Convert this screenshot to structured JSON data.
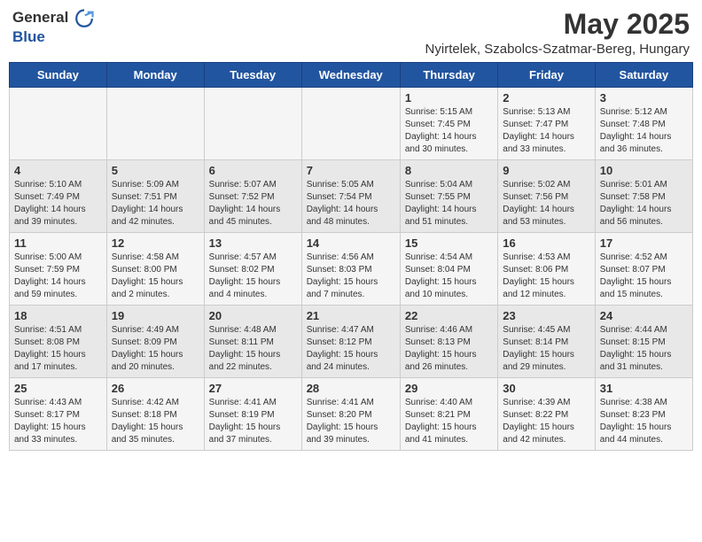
{
  "header": {
    "logo_general": "General",
    "logo_blue": "Blue",
    "month": "May 2025",
    "location": "Nyirtelek, Szabolcs-Szatmar-Bereg, Hungary"
  },
  "days_of_week": [
    "Sunday",
    "Monday",
    "Tuesday",
    "Wednesday",
    "Thursday",
    "Friday",
    "Saturday"
  ],
  "weeks": [
    [
      {
        "day": "",
        "info": ""
      },
      {
        "day": "",
        "info": ""
      },
      {
        "day": "",
        "info": ""
      },
      {
        "day": "",
        "info": ""
      },
      {
        "day": "1",
        "info": "Sunrise: 5:15 AM\nSunset: 7:45 PM\nDaylight: 14 hours\nand 30 minutes."
      },
      {
        "day": "2",
        "info": "Sunrise: 5:13 AM\nSunset: 7:47 PM\nDaylight: 14 hours\nand 33 minutes."
      },
      {
        "day": "3",
        "info": "Sunrise: 5:12 AM\nSunset: 7:48 PM\nDaylight: 14 hours\nand 36 minutes."
      }
    ],
    [
      {
        "day": "4",
        "info": "Sunrise: 5:10 AM\nSunset: 7:49 PM\nDaylight: 14 hours\nand 39 minutes."
      },
      {
        "day": "5",
        "info": "Sunrise: 5:09 AM\nSunset: 7:51 PM\nDaylight: 14 hours\nand 42 minutes."
      },
      {
        "day": "6",
        "info": "Sunrise: 5:07 AM\nSunset: 7:52 PM\nDaylight: 14 hours\nand 45 minutes."
      },
      {
        "day": "7",
        "info": "Sunrise: 5:05 AM\nSunset: 7:54 PM\nDaylight: 14 hours\nand 48 minutes."
      },
      {
        "day": "8",
        "info": "Sunrise: 5:04 AM\nSunset: 7:55 PM\nDaylight: 14 hours\nand 51 minutes."
      },
      {
        "day": "9",
        "info": "Sunrise: 5:02 AM\nSunset: 7:56 PM\nDaylight: 14 hours\nand 53 minutes."
      },
      {
        "day": "10",
        "info": "Sunrise: 5:01 AM\nSunset: 7:58 PM\nDaylight: 14 hours\nand 56 minutes."
      }
    ],
    [
      {
        "day": "11",
        "info": "Sunrise: 5:00 AM\nSunset: 7:59 PM\nDaylight: 14 hours\nand 59 minutes."
      },
      {
        "day": "12",
        "info": "Sunrise: 4:58 AM\nSunset: 8:00 PM\nDaylight: 15 hours\nand 2 minutes."
      },
      {
        "day": "13",
        "info": "Sunrise: 4:57 AM\nSunset: 8:02 PM\nDaylight: 15 hours\nand 4 minutes."
      },
      {
        "day": "14",
        "info": "Sunrise: 4:56 AM\nSunset: 8:03 PM\nDaylight: 15 hours\nand 7 minutes."
      },
      {
        "day": "15",
        "info": "Sunrise: 4:54 AM\nSunset: 8:04 PM\nDaylight: 15 hours\nand 10 minutes."
      },
      {
        "day": "16",
        "info": "Sunrise: 4:53 AM\nSunset: 8:06 PM\nDaylight: 15 hours\nand 12 minutes."
      },
      {
        "day": "17",
        "info": "Sunrise: 4:52 AM\nSunset: 8:07 PM\nDaylight: 15 hours\nand 15 minutes."
      }
    ],
    [
      {
        "day": "18",
        "info": "Sunrise: 4:51 AM\nSunset: 8:08 PM\nDaylight: 15 hours\nand 17 minutes."
      },
      {
        "day": "19",
        "info": "Sunrise: 4:49 AM\nSunset: 8:09 PM\nDaylight: 15 hours\nand 20 minutes."
      },
      {
        "day": "20",
        "info": "Sunrise: 4:48 AM\nSunset: 8:11 PM\nDaylight: 15 hours\nand 22 minutes."
      },
      {
        "day": "21",
        "info": "Sunrise: 4:47 AM\nSunset: 8:12 PM\nDaylight: 15 hours\nand 24 minutes."
      },
      {
        "day": "22",
        "info": "Sunrise: 4:46 AM\nSunset: 8:13 PM\nDaylight: 15 hours\nand 26 minutes."
      },
      {
        "day": "23",
        "info": "Sunrise: 4:45 AM\nSunset: 8:14 PM\nDaylight: 15 hours\nand 29 minutes."
      },
      {
        "day": "24",
        "info": "Sunrise: 4:44 AM\nSunset: 8:15 PM\nDaylight: 15 hours\nand 31 minutes."
      }
    ],
    [
      {
        "day": "25",
        "info": "Sunrise: 4:43 AM\nSunset: 8:17 PM\nDaylight: 15 hours\nand 33 minutes."
      },
      {
        "day": "26",
        "info": "Sunrise: 4:42 AM\nSunset: 8:18 PM\nDaylight: 15 hours\nand 35 minutes."
      },
      {
        "day": "27",
        "info": "Sunrise: 4:41 AM\nSunset: 8:19 PM\nDaylight: 15 hours\nand 37 minutes."
      },
      {
        "day": "28",
        "info": "Sunrise: 4:41 AM\nSunset: 8:20 PM\nDaylight: 15 hours\nand 39 minutes."
      },
      {
        "day": "29",
        "info": "Sunrise: 4:40 AM\nSunset: 8:21 PM\nDaylight: 15 hours\nand 41 minutes."
      },
      {
        "day": "30",
        "info": "Sunrise: 4:39 AM\nSunset: 8:22 PM\nDaylight: 15 hours\nand 42 minutes."
      },
      {
        "day": "31",
        "info": "Sunrise: 4:38 AM\nSunset: 8:23 PM\nDaylight: 15 hours\nand 44 minutes."
      }
    ]
  ]
}
